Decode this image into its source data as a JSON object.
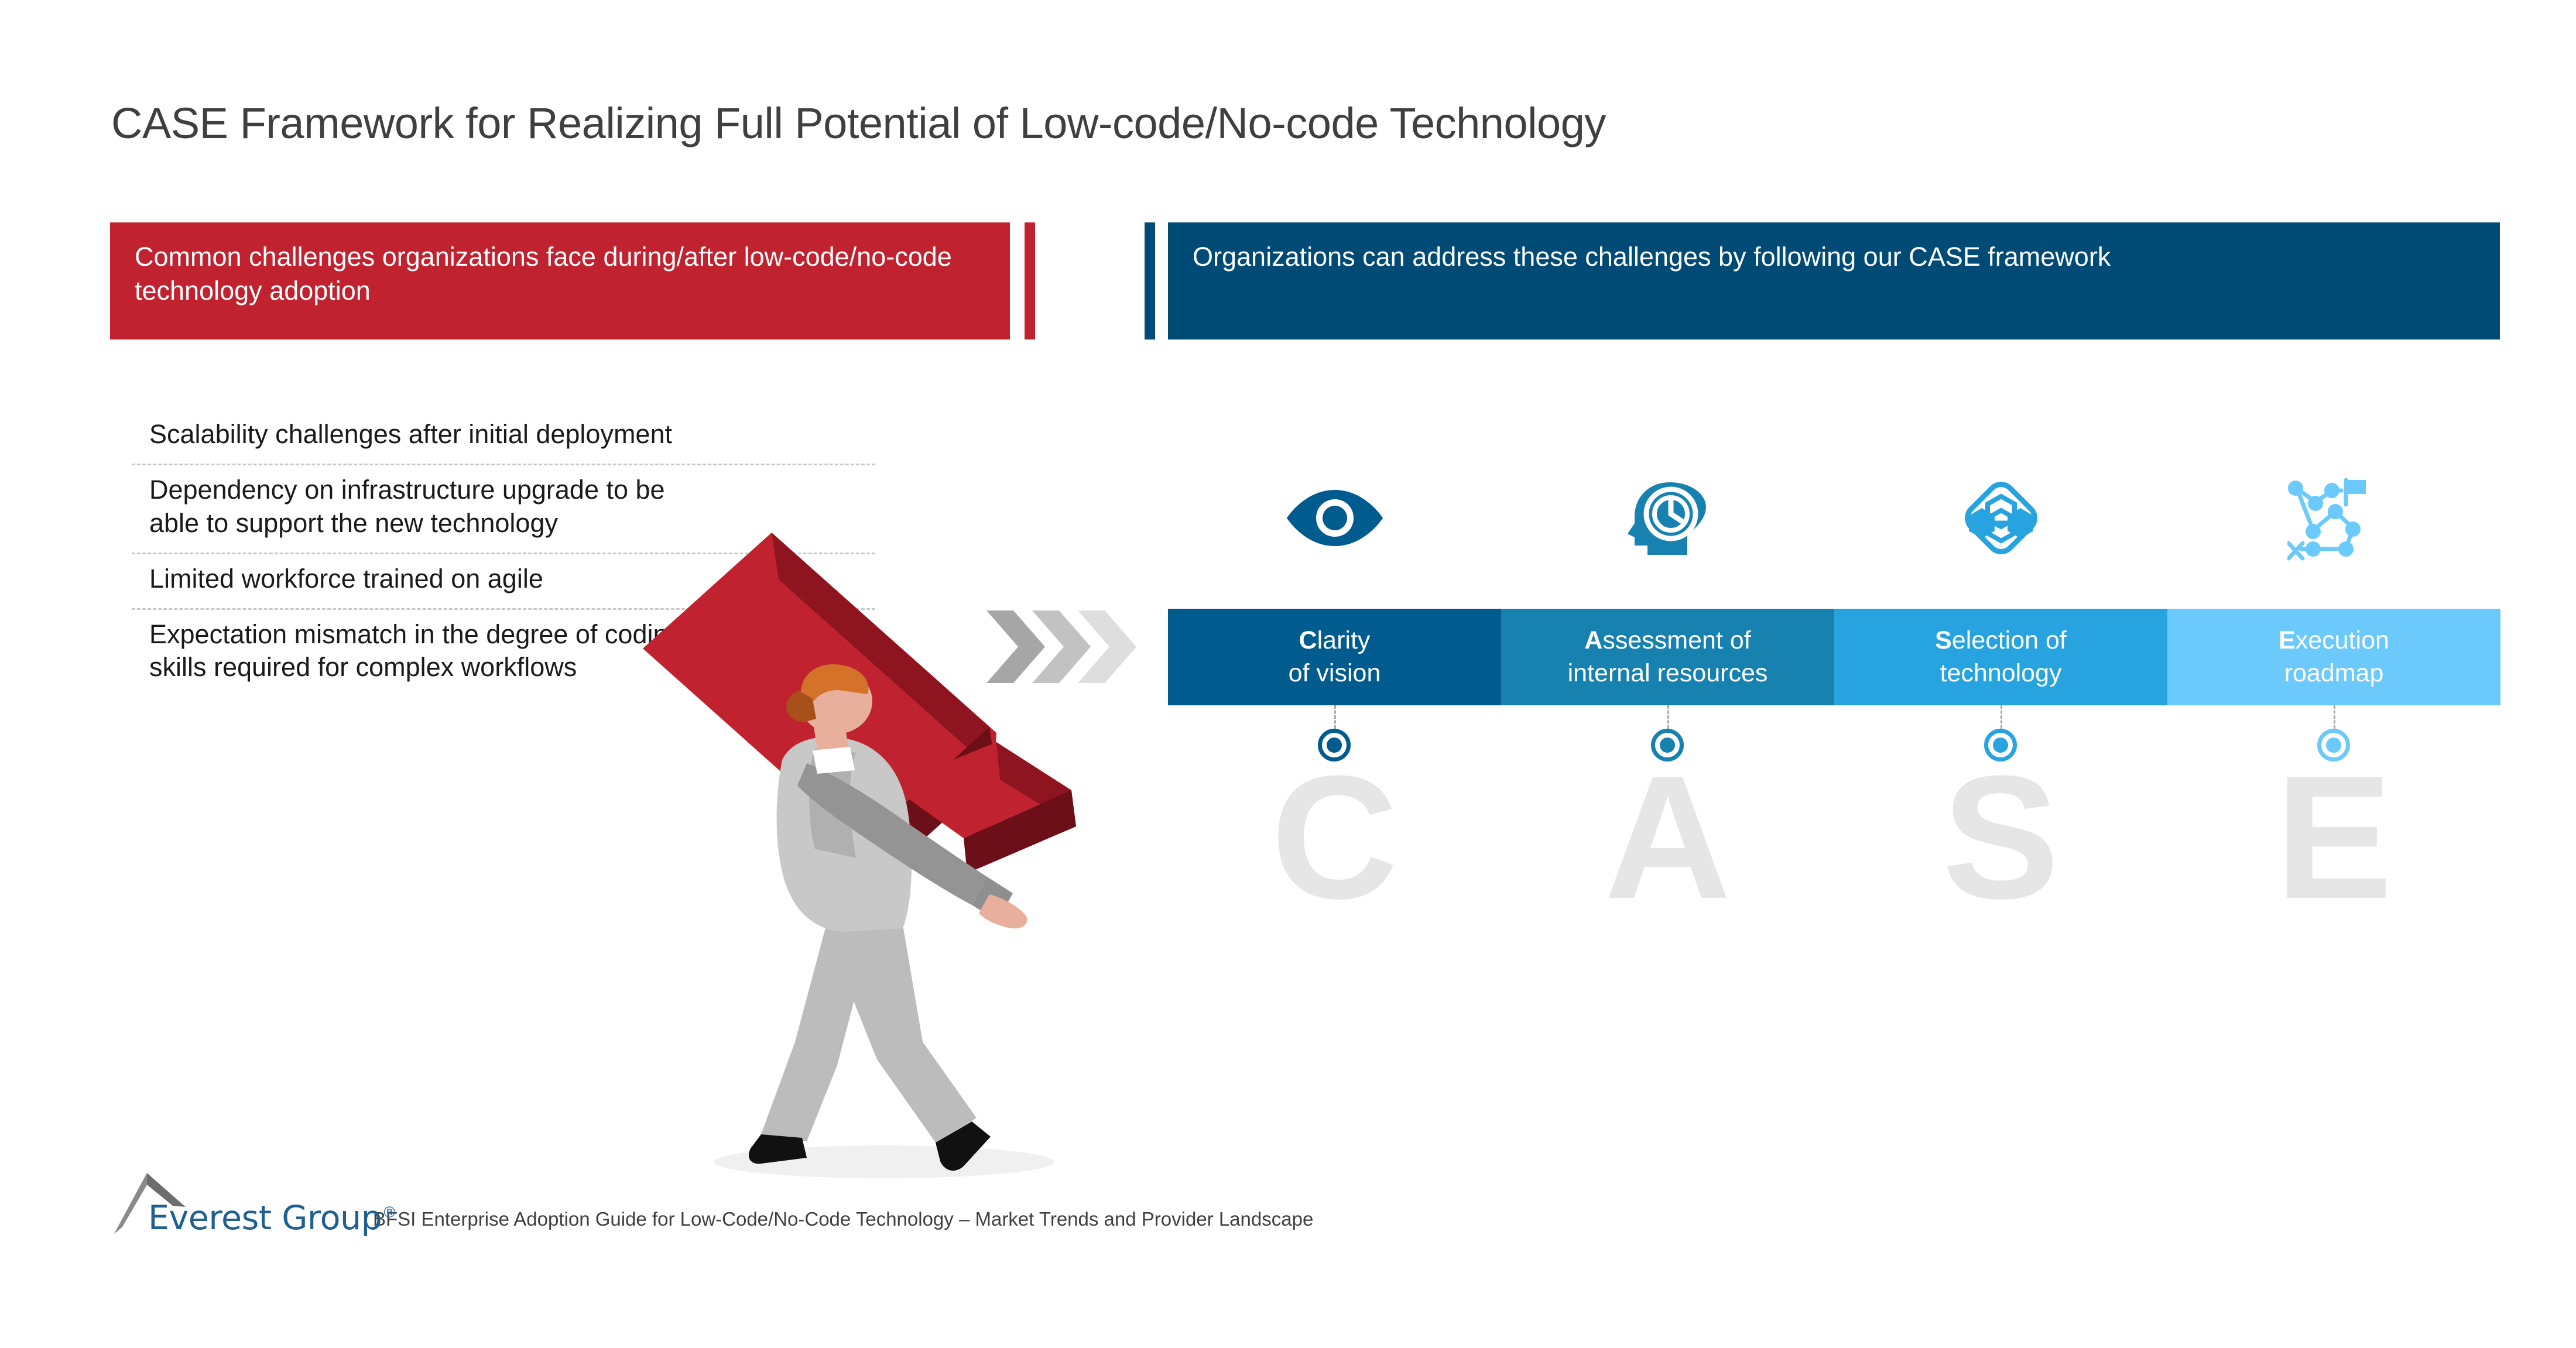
{
  "title": "CASE Framework for Realizing Full Potential of Low-code/No-code Technology",
  "banners": {
    "left": "Common challenges organizations face during/after low-code/no-code technology adoption",
    "right": "Organizations can address these challenges by following our CASE framework"
  },
  "challenges": [
    "Scalability challenges after initial deployment",
    "Dependency on infrastructure upgrade to be able to support the new technology",
    "Limited workforce trained on agile",
    "Expectation mismatch in the degree of coding skills required for complex workflows"
  ],
  "pillars": [
    {
      "letter": "C",
      "initial": "C",
      "label_rest": "larity",
      "line2": "of vision",
      "icon": "eye-icon",
      "color": "#005b8f"
    },
    {
      "letter": "A",
      "initial": "A",
      "label_rest": "ssessment of",
      "line2": "internal resources",
      "icon": "head-clock-icon",
      "color": "#1781b0"
    },
    {
      "letter": "S",
      "initial": "S",
      "label_rest": "election of",
      "line2": "technology",
      "icon": "tech-nodes-diamond-icon",
      "color": "#27a3e0"
    },
    {
      "letter": "E",
      "initial": "E",
      "label_rest": "xecution",
      "line2": "roadmap",
      "icon": "roadmap-icon",
      "color": "#6bc9fb"
    }
  ],
  "footer": {
    "logo_text": "Everest Group",
    "logo_mark": "mountain-peak-icon",
    "registered_symbol": "®",
    "caption": "BFSI Enterprise Adoption Guide for Low-Code/No-Code Technology – Market Trends and Provider Landscape"
  },
  "colors": {
    "red": "#c1222f",
    "dark_blue": "#004b75",
    "letter_gray": "#e6e6e6",
    "title_gray": "#3f3f3f"
  }
}
